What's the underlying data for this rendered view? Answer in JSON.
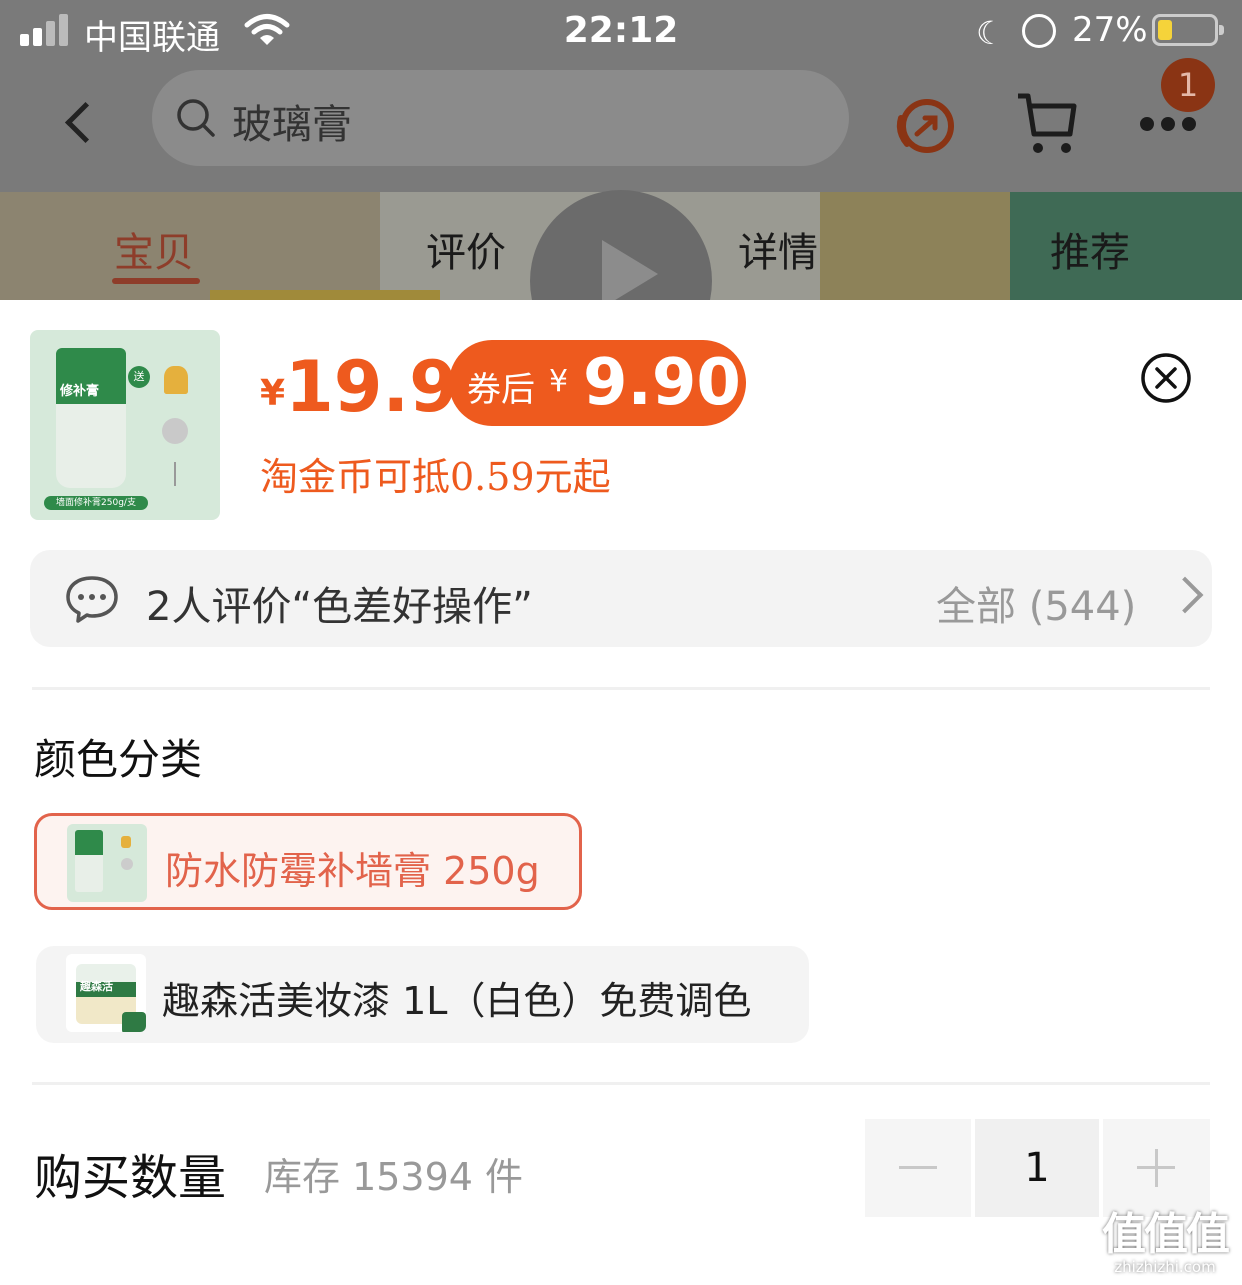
{
  "status_bar": {
    "carrier": "中国联通",
    "time": "22:12",
    "battery_percent": "27%",
    "battery_level": 0.27,
    "icons": [
      "signal-icon",
      "wifi-icon",
      "moon-icon",
      "rotation-lock-icon",
      "battery-icon"
    ]
  },
  "header": {
    "search_query": "玻璃膏",
    "cart_badge": "1",
    "icons": [
      "back-icon",
      "search-icon",
      "share-icon",
      "cart-icon",
      "more-icon"
    ]
  },
  "tabs": [
    {
      "label": "宝贝",
      "active": true
    },
    {
      "label": "评价",
      "active": false
    },
    {
      "label": "详情",
      "active": false
    },
    {
      "label": "推荐",
      "active": false
    }
  ],
  "product": {
    "thumb_label": "修补膏",
    "thumb_gift": "送",
    "thumb_caption": "墙面修补膏250g/支",
    "currency": "¥",
    "price": "19.9",
    "coupon_label": "券后",
    "coupon_currency": "¥",
    "coupon_price": "9.90",
    "coin_text": "淘金币可抵0.59元起"
  },
  "review": {
    "summary": "2人评价“色差好操作”",
    "all_label": "全部 (544)"
  },
  "options": {
    "title": "颜色分类",
    "items": [
      {
        "label": "防水防霉补墙膏 250g",
        "selected": true
      },
      {
        "label": "趣森活美妆漆 1L（白色）免费调色",
        "selected": false,
        "thumb_text": "趣森活"
      }
    ]
  },
  "quantity": {
    "title": "购买数量",
    "stock": "库存 15394 件",
    "value": "1"
  },
  "watermark": {
    "logo": "值值值",
    "url": "zhizhizhi.com"
  },
  "colors": {
    "accent": "#ee5a1e",
    "selected_border": "#e2634b",
    "tab_active": "#8e3d2a"
  }
}
